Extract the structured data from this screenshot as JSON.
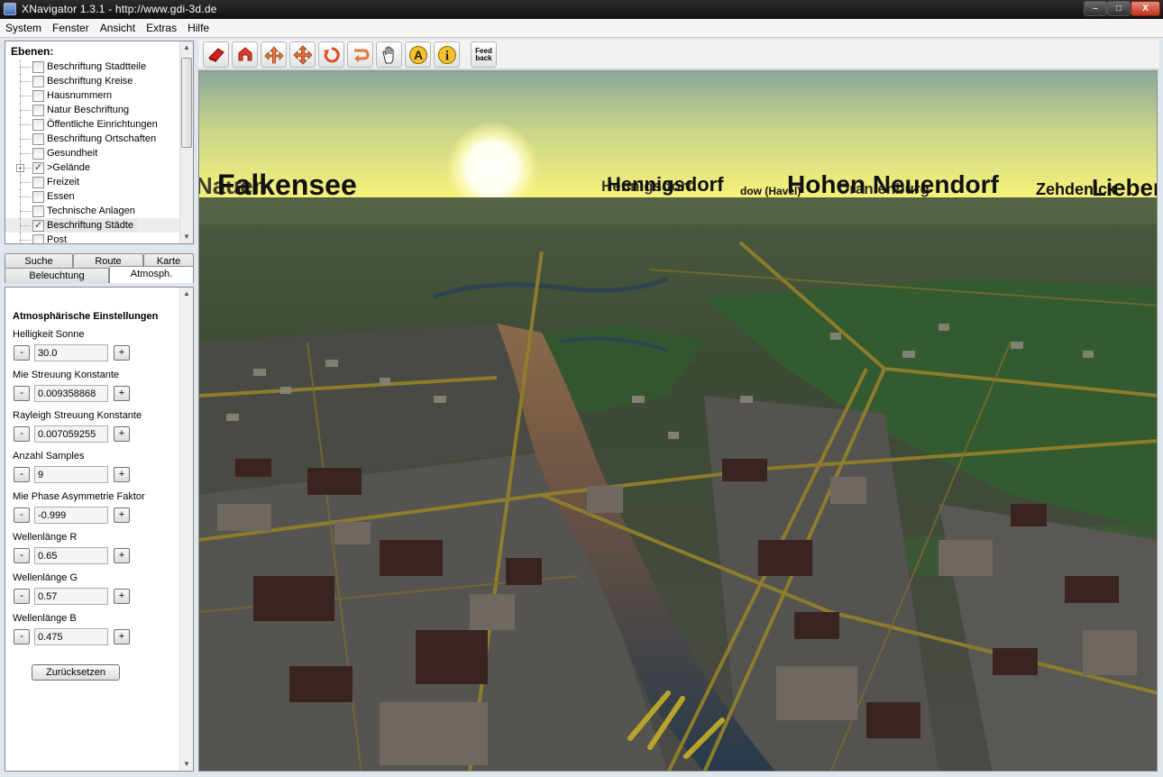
{
  "window": {
    "title": "XNavigator 1.3.1 - http://www.gdi-3d.de",
    "minimize": "–",
    "maximize": "□",
    "close": "X"
  },
  "menu": [
    "System",
    "Fenster",
    "Ansicht",
    "Extras",
    "Hilfe"
  ],
  "layers": {
    "title": "Ebenen:",
    "items": [
      {
        "label": "Beschriftung Stadtteile",
        "checked": false
      },
      {
        "label": "Beschriftung Kreise",
        "checked": false
      },
      {
        "label": "Hausnummern",
        "checked": false
      },
      {
        "label": "Natur Beschriftung",
        "checked": false
      },
      {
        "label": "Öffentliche Einrichtungen",
        "checked": false
      },
      {
        "label": "Beschriftung Ortschaften",
        "checked": false
      },
      {
        "label": "Gesundheit",
        "checked": false
      },
      {
        "label": ">Gelände",
        "checked": true,
        "expandable": true
      },
      {
        "label": "Freizeit",
        "checked": false
      },
      {
        "label": "Essen",
        "checked": false
      },
      {
        "label": "Technische Anlagen",
        "checked": false
      },
      {
        "label": "Beschriftung Städte",
        "checked": true,
        "selected": true
      },
      {
        "label": "Post",
        "checked": false
      }
    ]
  },
  "tabs": {
    "row1": [
      "Suche",
      "Route",
      "Karte"
    ],
    "row2": [
      "Beleuchtung",
      "Atmosph."
    ],
    "active": "Atmosph."
  },
  "atmosphere": {
    "heading": "Atmosphärische Einstellungen",
    "minus": "-",
    "plus": "+",
    "params": [
      {
        "label": "Helligkeit Sonne",
        "value": "30.0"
      },
      {
        "label": "Mie Streuung Konstante",
        "value": "0.009358868"
      },
      {
        "label": "Rayleigh Streuung Konstante",
        "value": "0.007059255"
      },
      {
        "label": "Anzahl Samples",
        "value": "9"
      },
      {
        "label": "Mie Phase Asymmetrie Faktor",
        "value": "-0.999"
      },
      {
        "label": "Wellenlänge R",
        "value": "0.65"
      },
      {
        "label": "Wellenlänge G",
        "value": "0.57"
      },
      {
        "label": "Wellenlänge B",
        "value": "0.475"
      }
    ],
    "reset": "Zurücksetzen"
  },
  "toolbar": {
    "tools": [
      "fly-icon",
      "lift-icon",
      "move-icon",
      "pan-icon",
      "rotate-icon",
      "turn-icon",
      "hand-icon",
      "annotation-icon",
      "info-icon",
      "feedback-icon"
    ],
    "annotation_glyph": "A",
    "info_glyph": "i",
    "feedback_label": "Feed back"
  },
  "map_labels": {
    "falkensee": "Falkensee",
    "nauen": "Nauen",
    "hennigsdorf": "Hennigsdorf",
    "hennigs2": "Hennigsdorf",
    "dow": "dow (Havel)",
    "hohen_neuendorf": "Hohen Neuendorf",
    "oranienburg": "Oranienburg",
    "zehdenick": "Zehdenick",
    "lieben": "Lieben"
  },
  "colors": {
    "titlebar": "#1a1a1a",
    "sky_top": "#8fae96",
    "sky_horizon": "#f6f27a",
    "terrain": "#3e4a36",
    "road": "#8f7f2c",
    "water": "#2a3e4a"
  }
}
